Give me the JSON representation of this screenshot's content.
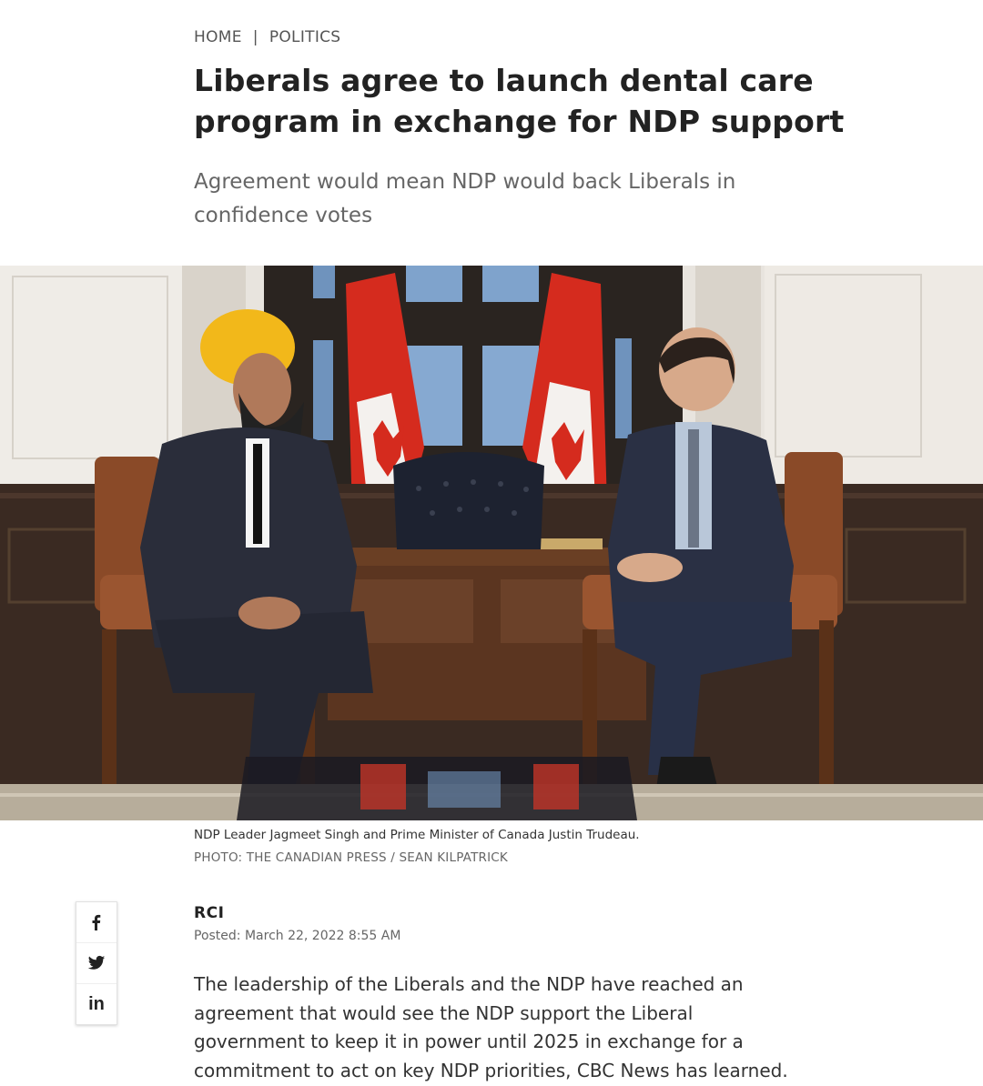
{
  "breadcrumb": {
    "home": "HOME",
    "separator": "|",
    "section": "POLITICS"
  },
  "article": {
    "headline": "Liberals agree to launch dental care program in exchange for NDP support",
    "dek": "Agreement would mean NDP would back Liberals in confidence votes",
    "photo": {
      "caption": "NDP Leader Jagmeet Singh and Prime Minister of Canada Justin Trudeau.",
      "credit": "PHOTO: THE CANADIAN PRESS / SEAN KILPATRICK"
    },
    "author": "RCI",
    "posted": "Posted: March 22, 2022 8:55 AM",
    "body": "The leadership of the Liberals and the NDP have reached an agreement that would see the NDP support the Liberal government to keep it in power until 2025 in exchange for a commitment to act on key NDP priorities, CBC News has learned."
  },
  "share": {
    "facebook_icon": "facebook-icon",
    "twitter_icon": "twitter-icon",
    "linkedin_icon": "linkedin-icon",
    "linkedin_glyph": "in"
  },
  "colors": {
    "headline": "#222222",
    "dek": "#666666",
    "flag_red": "#d52b1e"
  }
}
